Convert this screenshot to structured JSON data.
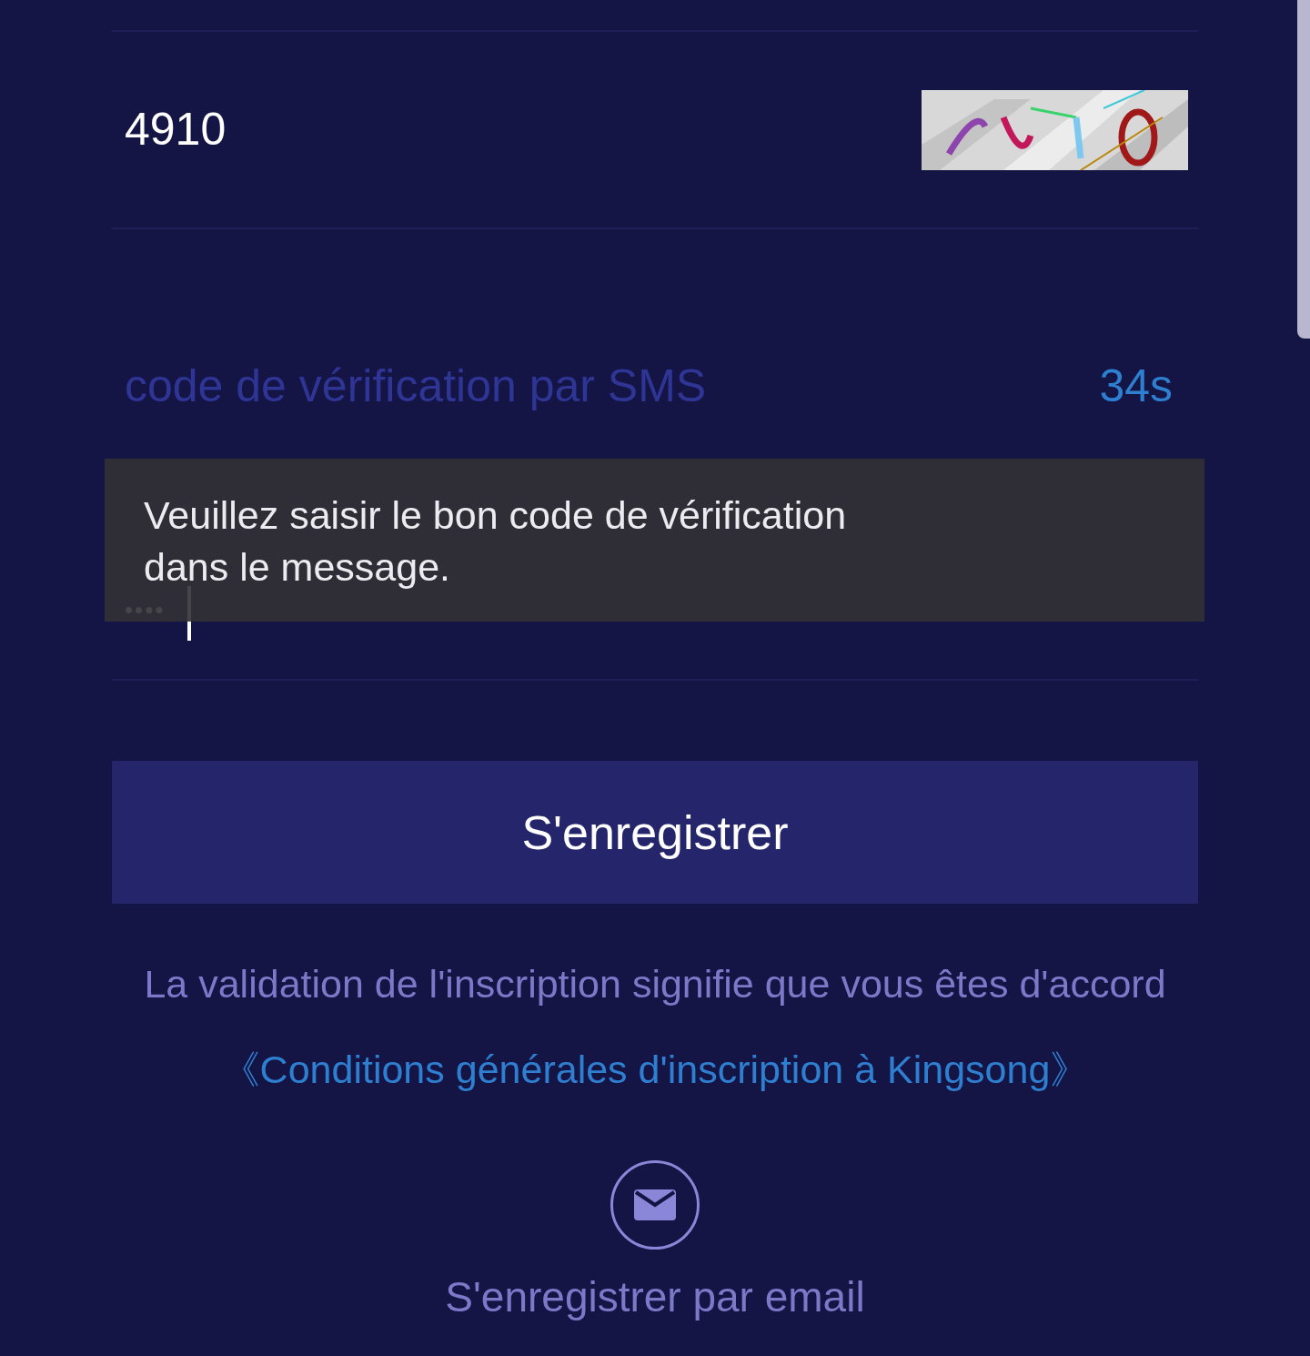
{
  "captcha_field": {
    "value": "4910"
  },
  "sms_field": {
    "placeholder": "code de vérification par SMS",
    "countdown": "34s"
  },
  "password_field": {
    "value": "••••",
    "focused": true
  },
  "toast": {
    "message": "Veuillez saisir le bon code de vérification\ndans le message."
  },
  "register_button": {
    "label": "S'enregistrer"
  },
  "terms": {
    "text": "La validation de l'inscription signifie que vous êtes d'accord",
    "link": "《Conditions générales d'inscription à Kingsong》"
  },
  "email_option": {
    "label": "S'enregistrer par email"
  }
}
